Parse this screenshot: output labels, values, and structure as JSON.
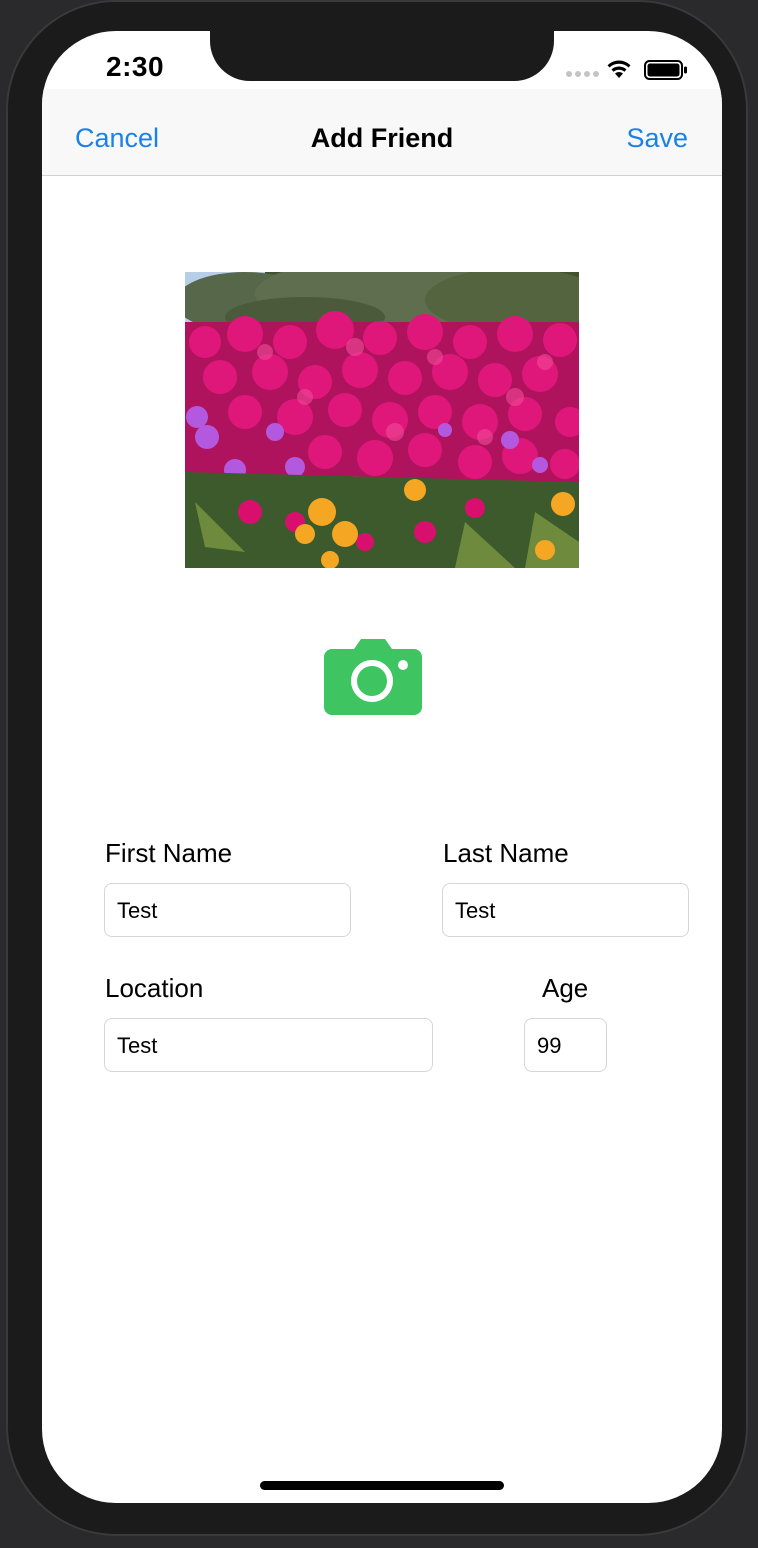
{
  "status_bar": {
    "time": "2:30"
  },
  "nav": {
    "cancel_label": "Cancel",
    "title": "Add Friend",
    "save_label": "Save"
  },
  "form": {
    "first_name": {
      "label": "First Name",
      "value": "Test"
    },
    "last_name": {
      "label": "Last Name",
      "value": "Test"
    },
    "location": {
      "label": "Location",
      "value": "Test"
    },
    "age": {
      "label": "Age",
      "value": "99"
    }
  },
  "icons": {
    "camera": "camera-icon",
    "wifi": "wifi-icon",
    "battery": "battery-icon"
  },
  "colors": {
    "accent": "#1a82e6",
    "camera_green": "#3ec460"
  }
}
